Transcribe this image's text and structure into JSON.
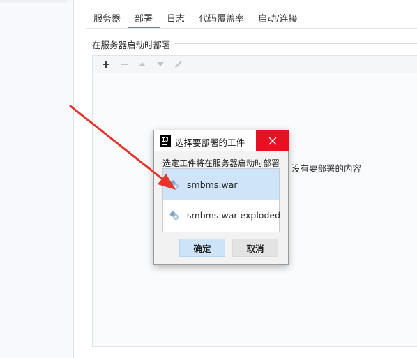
{
  "tabs": [
    "服务器",
    "部署",
    "日志",
    "代码覆盖率",
    "启动/连接"
  ],
  "active_tab": "部署",
  "deploy_section": {
    "title": "在服务器启动时部署",
    "empty_text": "没有要部署的内容",
    "toolbar": {
      "add_icon": "plus-icon",
      "remove_icon": "minus-icon",
      "up_icon": "arrow-up-icon",
      "down_icon": "arrow-down-icon",
      "edit_icon": "pencil-icon"
    }
  },
  "dialog": {
    "title": "选择要部署的工件",
    "app_icon_text": "IJ",
    "subtitle": "选定工件将在服务器启动时部署",
    "artifacts": [
      {
        "label": "smbms:war",
        "selected": true
      },
      {
        "label": "smbms:war exploded",
        "selected": false
      }
    ],
    "ok_label": "确定",
    "cancel_label": "取消"
  },
  "colors": {
    "accent_tab": "#e8467c",
    "close_button": "#e81123",
    "selection": "#cfe4f9",
    "annotation_arrow": "#e8332b"
  }
}
